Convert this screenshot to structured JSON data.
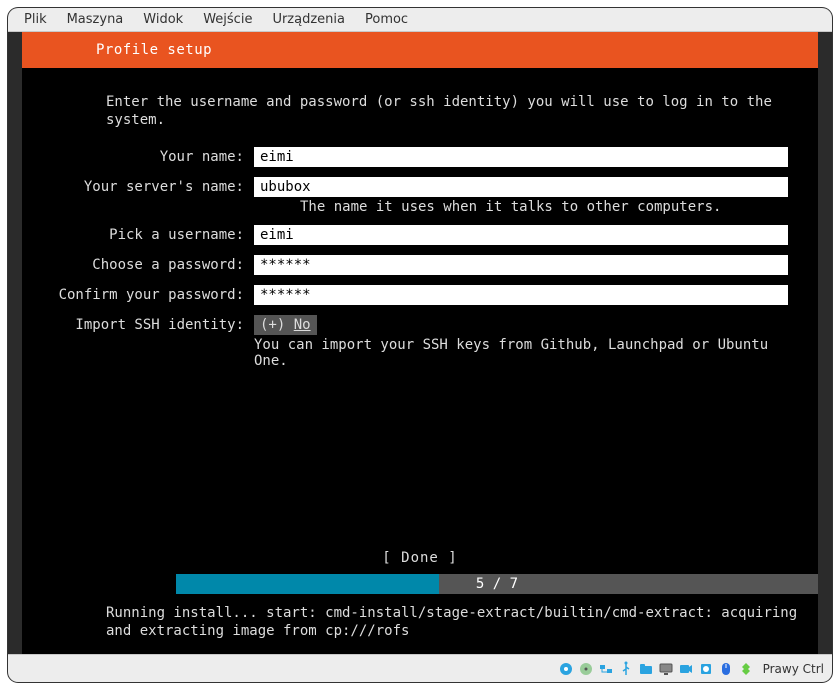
{
  "menubar": {
    "items": [
      "Plik",
      "Maszyna",
      "Widok",
      "Wejście",
      "Urządzenia",
      "Pomoc"
    ]
  },
  "installer": {
    "title": "Profile setup",
    "intro": "Enter the username and password (or ssh identity) you will use to log in to the system.",
    "fields": {
      "name_label": "Your name:",
      "name_value": "eimi",
      "server_label": "Your server's name:",
      "server_value": "ububox",
      "server_hint": "The name it uses when it talks to other computers.",
      "user_label": "Pick a username:",
      "user_value": "eimi",
      "pass_label": "Choose a password:",
      "pass_value": "******",
      "confirm_label": "Confirm your password:",
      "confirm_value": "******",
      "ssh_label": "Import SSH identity:",
      "ssh_toggle_prefix": "(+) ",
      "ssh_toggle_value": "No",
      "ssh_hint": "You can import your SSH keys from Github, Launchpad or Ubuntu One."
    },
    "done_label": "[ Done      ]",
    "progress": {
      "text": "5 / 7",
      "percent": 41
    },
    "log": "Running install... start: cmd-install/stage-extract/builtin/cmd-extract: acquiring and extracting image from cp:///rofs"
  },
  "statusbar": {
    "hostkey": "Prawy Ctrl"
  }
}
